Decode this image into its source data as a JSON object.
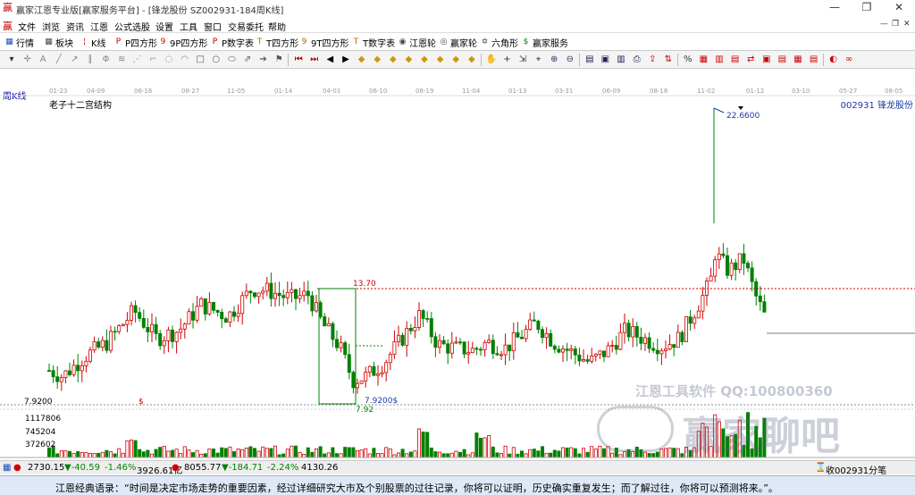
{
  "window": {
    "title": "赢家江恩专业版[赢家服务平台] - [锋龙股份  SZ002931-184周K线]",
    "controls": [
      "—",
      "❐",
      "✕"
    ]
  },
  "menu": {
    "items": [
      "文件",
      "浏览",
      "资讯",
      "江恩",
      "公式选股",
      "设置",
      "工具",
      "窗口",
      "交易委托",
      "帮助"
    ],
    "mdi_controls": [
      "—",
      "❐",
      "✕"
    ]
  },
  "toolbar1": {
    "items": [
      {
        "label": "行情",
        "icon": "grid-icon",
        "glyph": "▦",
        "color": "#1a4fb8"
      },
      {
        "label": "板块",
        "icon": "blocks-icon",
        "glyph": "▦",
        "color": "#444"
      },
      {
        "label": "K线",
        "icon": "kline-icon",
        "glyph": "¦",
        "color": "#c00"
      },
      {
        "label": "P四方形",
        "icon": "p-square-icon",
        "glyph": "P",
        "color": "#c00"
      },
      {
        "label": "9P四方形",
        "icon": "9p-square-icon",
        "glyph": "9",
        "color": "#c00"
      },
      {
        "label": "P数字表",
        "icon": "p-table-icon",
        "glyph": "P",
        "color": "#a00"
      },
      {
        "label": "T四方形",
        "icon": "t-square-icon",
        "glyph": "T",
        "color": "#b60"
      },
      {
        "label": "9T四方形",
        "icon": "9t-square-icon",
        "glyph": "9",
        "color": "#b60"
      },
      {
        "label": "T数字表",
        "icon": "t-table-icon",
        "glyph": "T",
        "color": "#b60"
      },
      {
        "label": "江恩轮",
        "icon": "gann-wheel-icon",
        "glyph": "◉",
        "color": "#444"
      },
      {
        "label": "赢家轮",
        "icon": "winner-wheel-icon",
        "glyph": "◎",
        "color": "#444"
      },
      {
        "label": "六角形",
        "icon": "hexagon-icon",
        "glyph": "✡",
        "color": "#444"
      },
      {
        "label": "赢家服务",
        "icon": "service-icon",
        "glyph": "$",
        "color": "#080"
      }
    ]
  },
  "toolbar2": {
    "icons": [
      "pointer-icon",
      "crosshair-icon",
      "text-icon",
      "line-icon",
      "ray-icon",
      "parallel-icon",
      "fib-icon",
      "channel-icon",
      "gann-fan-icon",
      "bracket-icon",
      "cycle-icon",
      "arc-icon",
      "box-icon",
      "circle-icon",
      "ellipse-icon",
      "speed-icon",
      "arrow-icon",
      "flag-icon",
      "rewind-icon",
      "play-icon",
      "left-icon",
      "right-icon",
      "diamond1-icon",
      "diamond2-icon",
      "diamond3-icon",
      "diamond4-icon",
      "diamond5-icon",
      "diamond6-icon",
      "diamond7-icon",
      "diamond8-icon",
      "hand-icon",
      "plus-icon",
      "measure-icon",
      "tag-icon",
      "zoomin-icon",
      "zoomout-icon",
      "calc-icon",
      "window-icon",
      "save-icon",
      "print-icon",
      "export-icon",
      "chart-toggle-icon",
      "percent-icon",
      "grid-toggle-icon",
      "vol-icon",
      "period-icon",
      "sync-icon",
      "option-icon",
      "multi-icon",
      "layout-icon",
      "table-icon",
      "color-icon",
      "infinity-icon"
    ]
  },
  "chart": {
    "period_label": "周K线",
    "name": "老子十二宫结构",
    "stock": "002931  锋龙股份",
    "date_ticks": [
      "01-23",
      "04-09",
      "06-16",
      "08-27",
      "11-05",
      "01-14",
      "04-01",
      "06-10",
      "08-19",
      "11-04",
      "01-13",
      "03-31",
      "06-09",
      "08-18",
      "11-02",
      "01-12",
      "03-10",
      "05-27",
      "08-05"
    ],
    "price_labels": {
      "high": "22.6600",
      "level": "13.70",
      "low_a": "7.9200$",
      "low_b": "7.92",
      "axis": "7.9200",
      "dollar": "$"
    },
    "volume_axis": [
      "1117806",
      "745204",
      "372602"
    ],
    "colors": {
      "up": "#d00000",
      "down": "#008000",
      "box": "#008000",
      "level": "#d00000"
    }
  },
  "status": {
    "sh_index": "2730.15",
    "sh_change": "▼-40.59",
    "sh_pct": "-1.46%",
    "sh_amount": "3926.61亿",
    "sz_index": "8055.77",
    "sz_change": "▼-184.71",
    "sz_pct": "-2.24%",
    "sz_amount": "4130.26",
    "right": "收002931分笔"
  },
  "quote": "江恩经典语录：“时间是决定市场走势的重要因素，经过详细研究大市及个别股票的过往记录，你将可以证明，历史确实重复发生；而了解过往，你将可以预测将来。”。",
  "watermark": {
    "line1": "江恩工具软件  QQ:100800360",
    "line2": "赢家聊吧"
  }
}
